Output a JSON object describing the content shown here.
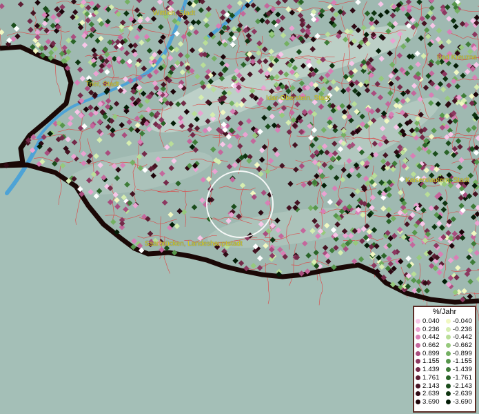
{
  "map": {
    "cities": [
      {
        "id": "wittlich",
        "label": "Wittlich, Stadt"
      },
      {
        "id": "trier",
        "label": "Trier, Stadt"
      },
      {
        "id": "idar-oberstein",
        "label": "Idar-Oberstein, Stadt"
      },
      {
        "id": "bad-kreuznach",
        "label": "Bad Kreuzna"
      },
      {
        "id": "kaiserslautern",
        "label": "Kaiserslautern, Stadt"
      },
      {
        "id": "saarbruecken",
        "label": "Saarbrücken, Landeshauptstadt"
      }
    ],
    "colors": {
      "terrain": "#9fb9b1",
      "boundary": "#e04040",
      "water": "#4ea3d6",
      "outside_mask": "#1a0806"
    }
  },
  "legend": {
    "title": "%/Jahr",
    "positive": [
      {
        "label": "0.040",
        "color": "#f7c6e8"
      },
      {
        "label": "0.236",
        "color": "#eba2d2"
      },
      {
        "label": "0.442",
        "color": "#d97fb6"
      },
      {
        "label": "0.662",
        "color": "#c4679c"
      },
      {
        "label": "0.899",
        "color": "#a94d7e"
      },
      {
        "label": "1.155",
        "color": "#8c3860"
      },
      {
        "label": "1.439",
        "color": "#742a49"
      },
      {
        "label": "1.761",
        "color": "#5c1e33"
      },
      {
        "label": "2.143",
        "color": "#451322"
      },
      {
        "label": "2.639",
        "color": "#2f0a14"
      },
      {
        "label": "3.690",
        "color": "#1b0308"
      }
    ],
    "negative": [
      {
        "label": "-0.040",
        "color": "#f1f8c2"
      },
      {
        "label": "-0.236",
        "color": "#d6eeb0"
      },
      {
        "label": "-0.442",
        "color": "#b9de98"
      },
      {
        "label": "-0.662",
        "color": "#96c97c"
      },
      {
        "label": "-0.899",
        "color": "#74b062"
      },
      {
        "label": "-1.155",
        "color": "#56964b"
      },
      {
        "label": "-1.439",
        "color": "#3e7c38"
      },
      {
        "label": "-1.761",
        "color": "#2a6428"
      },
      {
        "label": "-2.143",
        "color": "#1a4c1b"
      },
      {
        "label": "-2.639",
        "color": "#0e3410"
      },
      {
        "label": "-3.690",
        "color": "#031c06"
      }
    ]
  }
}
